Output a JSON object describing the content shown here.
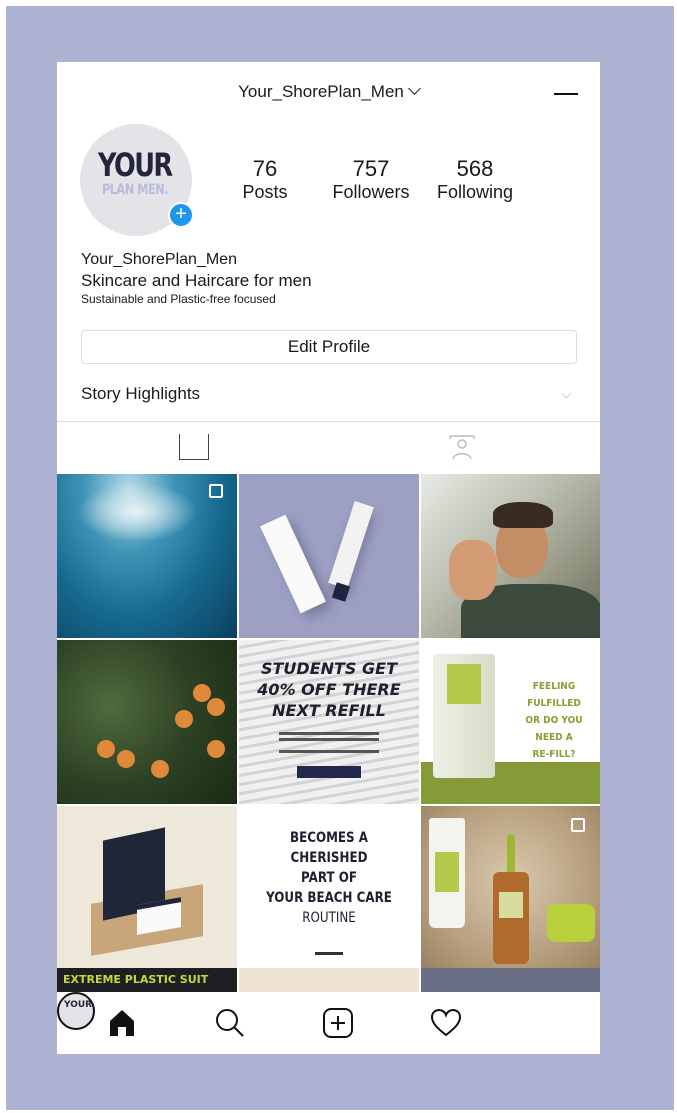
{
  "header": {
    "username": "Your_ShorePlan_Men"
  },
  "avatar": {
    "logo_line1": "YOUR",
    "logo_line2": "PLAN MEN."
  },
  "stats": {
    "posts": {
      "value": "76",
      "label": "Posts"
    },
    "followers": {
      "value": "757",
      "label": "Followers"
    },
    "following": {
      "value": "568",
      "label": "Following"
    }
  },
  "bio": {
    "name": "Your_ShorePlan_Men",
    "tagline": "Skincare and Haircare for men",
    "subline": "Sustainable and Plastic-free focused"
  },
  "profile": {
    "edit_label": "Edit Profile",
    "highlights_label": "Story Highlights"
  },
  "posts": {
    "post5": {
      "headline": [
        "STUDENTS GET",
        "40% OFF THERE",
        "NEXT REFILL"
      ]
    },
    "post6": {
      "text": [
        "FEELING FULFILLED",
        "OR DO YOU NEED A",
        "RE-FILL?"
      ]
    },
    "post7": {
      "strip": "EXTREME  PLASTIC  SUIT"
    },
    "post8": {
      "quote": [
        "BECOMES A",
        "CHERISHED",
        "PART OF",
        "YOUR BEACH CARE",
        "ROUTINE"
      ]
    }
  },
  "icons": {
    "accent_blue": "#1e96f0",
    "brand_green": "#859b37",
    "frame_lavender": "#aeb2d3"
  }
}
